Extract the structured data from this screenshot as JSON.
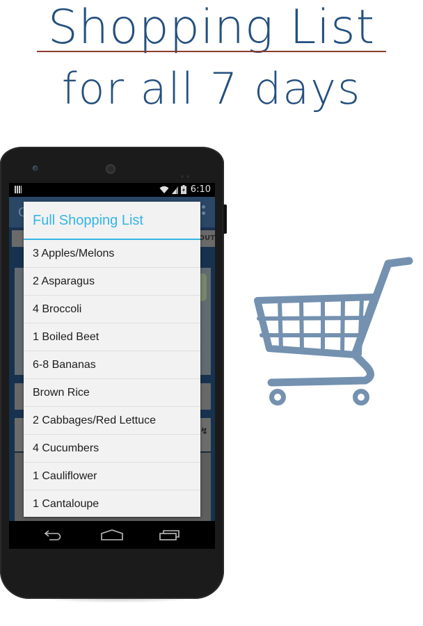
{
  "promo": {
    "headline_line1": "Shopping List",
    "headline_line2": "for all 7 days",
    "headline_color": "#24507e",
    "underline_color": "#8a3a2e"
  },
  "status_bar": {
    "time": "6:10",
    "icons": [
      "notification-icon",
      "wifi-icon",
      "signal-icon",
      "battery-charging-icon"
    ]
  },
  "background_app": {
    "title_fragment": "G",
    "tab_fragment": "OUT",
    "overflow_icon": "overflow-menu-icon"
  },
  "dialog": {
    "title": "Full Shopping List",
    "accent_color": "#33b5e5",
    "items": [
      "3 Apples/Melons",
      "2 Asparagus",
      "4 Broccoli",
      "1 Boiled Beet",
      "6-8 Bananas",
      "Brown Rice",
      "2 Cabbages/Red Lettuce",
      "4 Cucumbers",
      "1 Cauliflower",
      "1 Cantaloupe"
    ]
  },
  "nav_bar": {
    "buttons": [
      "back-icon",
      "home-icon",
      "recent-apps-icon"
    ]
  },
  "decoration": {
    "cart_icon": "shopping-cart-icon",
    "cart_color": "#7491b0"
  }
}
